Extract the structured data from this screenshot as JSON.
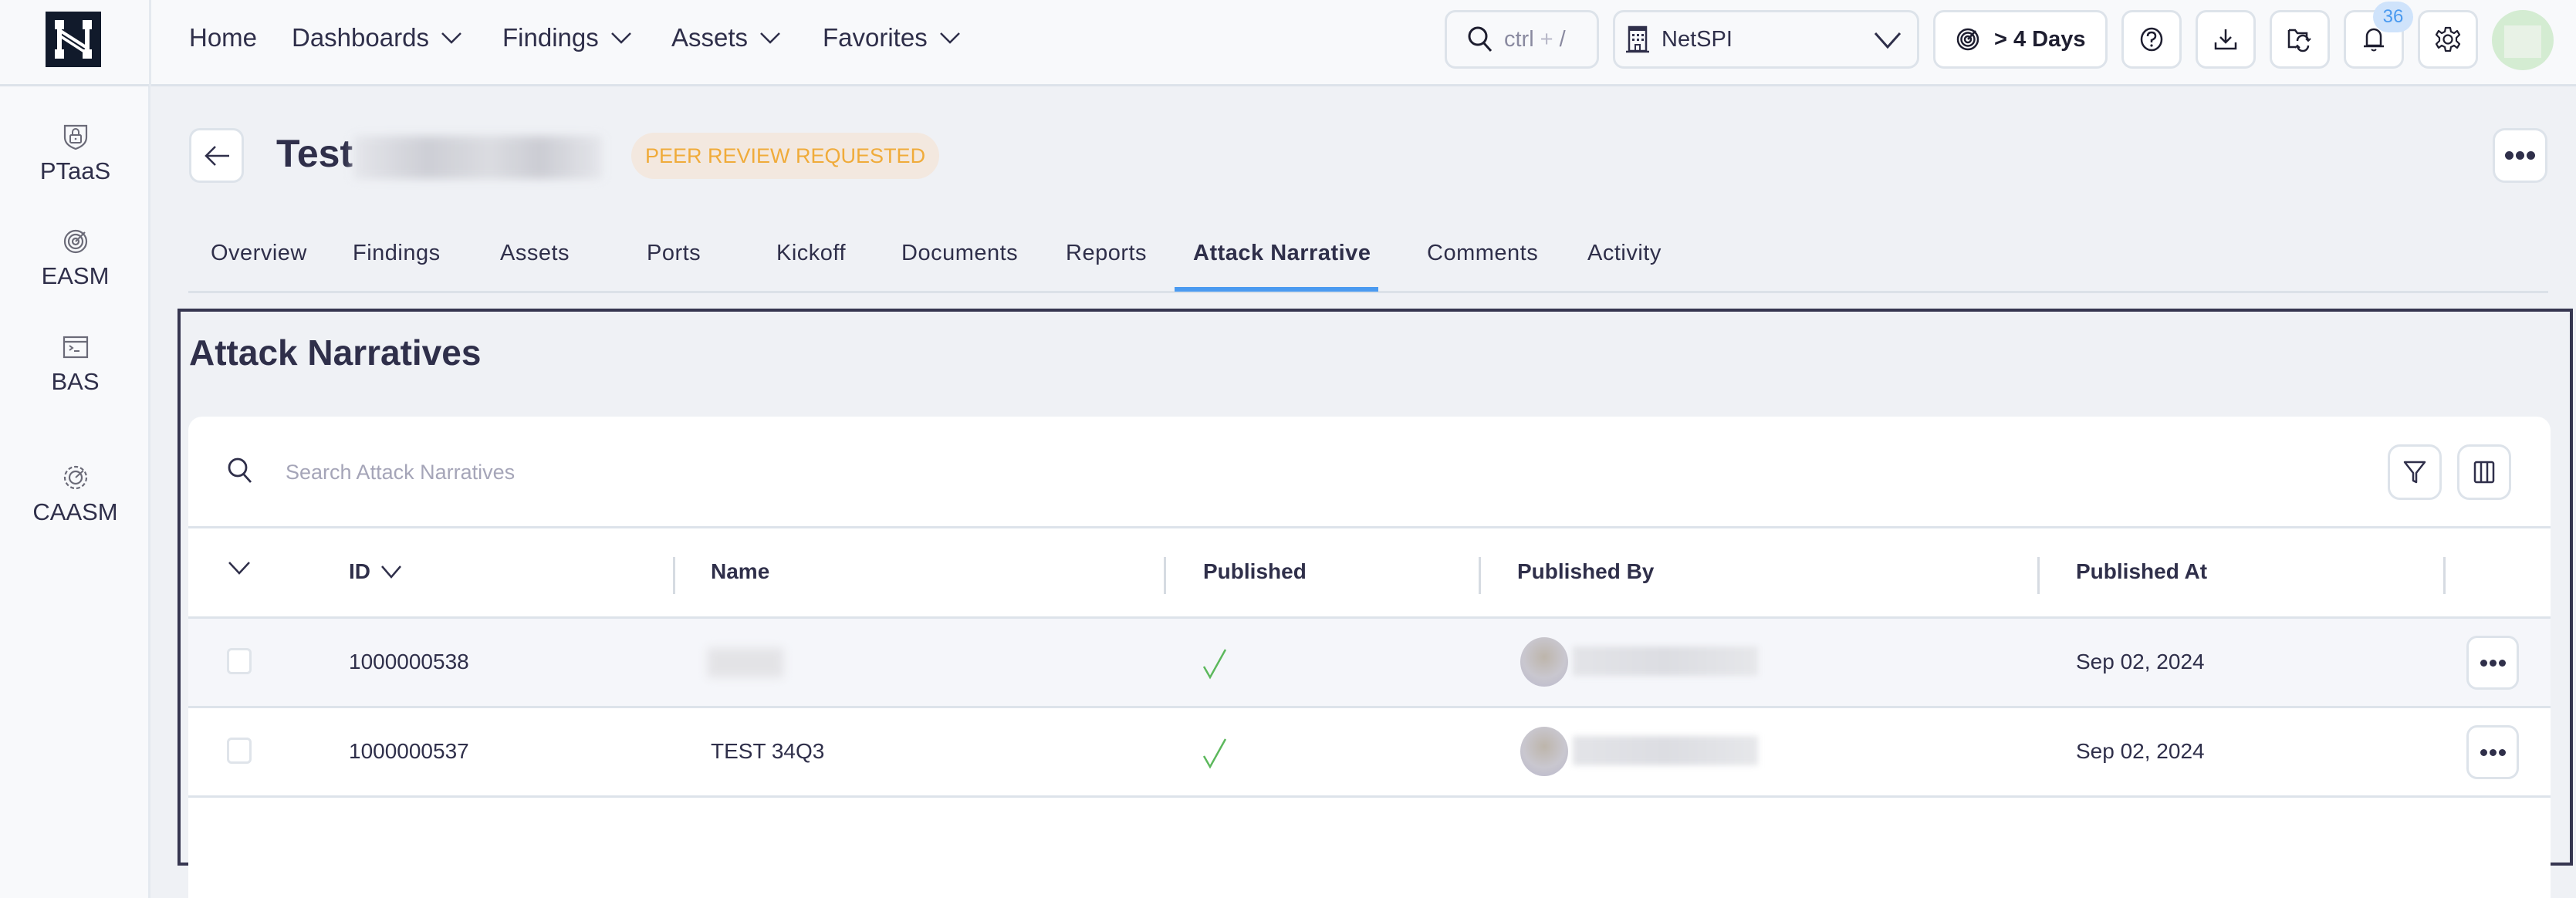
{
  "topnav": {
    "items": [
      {
        "label": "Home",
        "has_dropdown": false
      },
      {
        "label": "Dashboards",
        "has_dropdown": true
      },
      {
        "label": "Findings",
        "has_dropdown": true
      },
      {
        "label": "Assets",
        "has_dropdown": true
      },
      {
        "label": "Favorites",
        "has_dropdown": true
      }
    ],
    "search_shortcut_key": "ctrl",
    "search_shortcut_plus": "+",
    "search_shortcut_slash": "/",
    "organization": "NetSPI",
    "days_label": "> 4 Days",
    "notification_count": "36",
    "icons": [
      "help-icon",
      "download-icon",
      "folder-sync-icon",
      "bell-icon",
      "gear-icon"
    ]
  },
  "sidebar": {
    "items": [
      {
        "label": "PTaaS",
        "icon": "shield-lock-icon"
      },
      {
        "label": "EASM",
        "icon": "target-icon"
      },
      {
        "label": "BAS",
        "icon": "terminal-icon"
      },
      {
        "label": "CAASM",
        "icon": "dashed-target-icon"
      }
    ]
  },
  "page": {
    "title_prefix": "Test",
    "status": "PEER REVIEW REQUESTED",
    "status_color": "#f0ab3a"
  },
  "tabs": [
    {
      "label": "Overview",
      "active": false
    },
    {
      "label": "Findings",
      "active": false
    },
    {
      "label": "Assets",
      "active": false
    },
    {
      "label": "Ports",
      "active": false
    },
    {
      "label": "Kickoff",
      "active": false
    },
    {
      "label": "Documents",
      "active": false
    },
    {
      "label": "Reports",
      "active": false
    },
    {
      "label": "Attack Narrative",
      "active": true
    },
    {
      "label": "Comments",
      "active": false
    },
    {
      "label": "Activity",
      "active": false
    }
  ],
  "section": {
    "title": "Attack Narratives",
    "search_placeholder": "Search Attack Narratives",
    "search_value": ""
  },
  "table": {
    "columns": [
      "ID",
      "Name",
      "Published",
      "Published By",
      "Published At"
    ],
    "rows": [
      {
        "id": "1000000538",
        "name": "",
        "name_redacted": true,
        "published": true,
        "published_by_redacted": true,
        "published_at": "Sep 02, 2024"
      },
      {
        "id": "1000000537",
        "name": "TEST 34Q3",
        "name_redacted": false,
        "published": true,
        "published_by_redacted": true,
        "published_at": "Sep 02, 2024"
      }
    ]
  },
  "colors": {
    "accent": "#4a9af0",
    "check": "#5cb85c",
    "text": "#2f2f4a",
    "frame": "#363650"
  }
}
